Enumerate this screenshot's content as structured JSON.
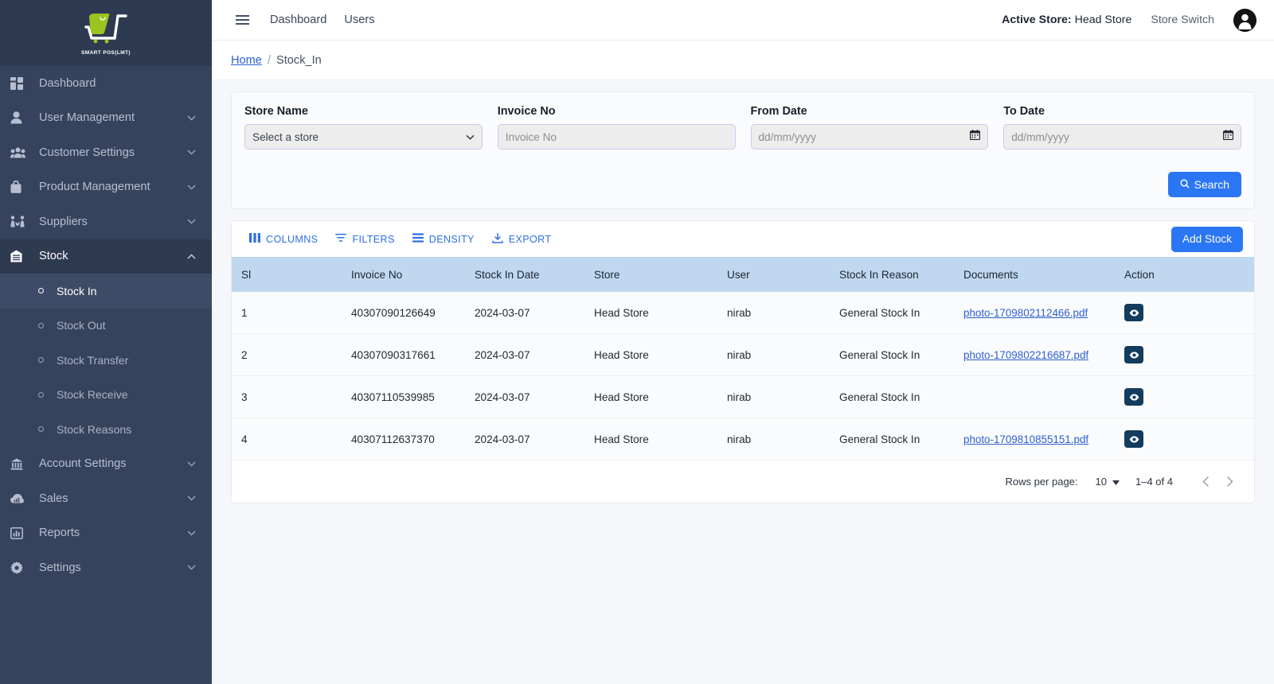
{
  "brand": {
    "name": "SMART POS",
    "suffix": "(LMT)"
  },
  "topbar": {
    "menu_toggle": "menu-toggle",
    "nav": [
      {
        "label": "Dashboard"
      },
      {
        "label": "Users"
      }
    ],
    "active_store_label": "Active Store:",
    "active_store_value": "Head Store",
    "store_switch": "Store Switch"
  },
  "breadcrumb": {
    "home": "Home",
    "separator": "/",
    "current": "Stock_In"
  },
  "sidebar": {
    "items": [
      {
        "label": "Dashboard",
        "icon": "grid-icon",
        "expandable": false
      },
      {
        "label": "User Management",
        "icon": "user-icon",
        "expandable": true
      },
      {
        "label": "Customer Settings",
        "icon": "users-group-icon",
        "expandable": true
      },
      {
        "label": "Product Management",
        "icon": "bag-icon",
        "expandable": true
      },
      {
        "label": "Suppliers",
        "icon": "handshake-icon",
        "expandable": true
      },
      {
        "label": "Stock",
        "icon": "warehouse-icon",
        "expandable": true,
        "expanded": true
      },
      {
        "label": "Account Settings",
        "icon": "bank-icon",
        "expandable": true
      },
      {
        "label": "Sales",
        "icon": "sales-cloud-icon",
        "expandable": true
      },
      {
        "label": "Reports",
        "icon": "chart-icon",
        "expandable": true
      },
      {
        "label": "Settings",
        "icon": "gear-icon",
        "expandable": true
      }
    ],
    "stock_submenu": [
      {
        "label": "Stock In",
        "active": true
      },
      {
        "label": "Stock Out",
        "active": false
      },
      {
        "label": "Stock Transfer",
        "active": false
      },
      {
        "label": "Stock Receive",
        "active": false
      },
      {
        "label": "Stock Reasons",
        "active": false
      }
    ]
  },
  "filters": {
    "store_name": {
      "label": "Store Name",
      "value": "Select a store"
    },
    "invoice_no": {
      "label": "Invoice No",
      "value": "",
      "placeholder": "Invoice No"
    },
    "from_date": {
      "label": "From Date",
      "value": "",
      "placeholder": "dd/mm/yyyy"
    },
    "to_date": {
      "label": "To Date",
      "value": "",
      "placeholder": "dd/mm/yyyy"
    },
    "search_button": "Search"
  },
  "table_toolbar": {
    "columns": "COLUMNS",
    "filters": "FILTERS",
    "density": "DENSITY",
    "export": "EXPORT",
    "add_stock": "Add Stock"
  },
  "table": {
    "headers": [
      "Sl",
      "Invoice No",
      "Stock In Date",
      "Store",
      "User",
      "Stock In Reason",
      "Documents",
      "Action"
    ],
    "rows": [
      {
        "sl": "1",
        "invoice_no": "40307090126649",
        "stock_in_date": "2024-03-07",
        "store": "Head Store",
        "user": "nirab",
        "reason": "General Stock In",
        "document": "photo-1709802112466.pdf",
        "action_icon": "eye-icon"
      },
      {
        "sl": "2",
        "invoice_no": "40307090317661",
        "stock_in_date": "2024-03-07",
        "store": "Head Store",
        "user": "nirab",
        "reason": "General Stock In",
        "document": "photo-1709802216687.pdf",
        "action_icon": "eye-icon"
      },
      {
        "sl": "3",
        "invoice_no": "40307110539985",
        "stock_in_date": "2024-03-07",
        "store": "Head Store",
        "user": "nirab",
        "reason": "General Stock In",
        "document": "",
        "action_icon": "eye-icon"
      },
      {
        "sl": "4",
        "invoice_no": "40307112637370",
        "stock_in_date": "2024-03-07",
        "store": "Head Store",
        "user": "nirab",
        "reason": "General Stock In",
        "document": "photo-1709810855151.pdf",
        "action_icon": "eye-icon"
      }
    ]
  },
  "pagination": {
    "rows_per_page_label": "Rows per page:",
    "rows_per_page_value": "10",
    "range": "1–4 of 4",
    "prev": "previous-page",
    "next": "next-page"
  },
  "colors": {
    "sidebar_bg": "#36435c",
    "sidebar_header_bg": "#2d3a52",
    "accent_blue": "#2a76f5",
    "link_blue": "#2d5fd0",
    "table_header_bg": "#bfd8f0",
    "action_btn_bg": "#133c5e",
    "page_bg": "#f6f7fa",
    "logo_green": "#9ac41f"
  }
}
